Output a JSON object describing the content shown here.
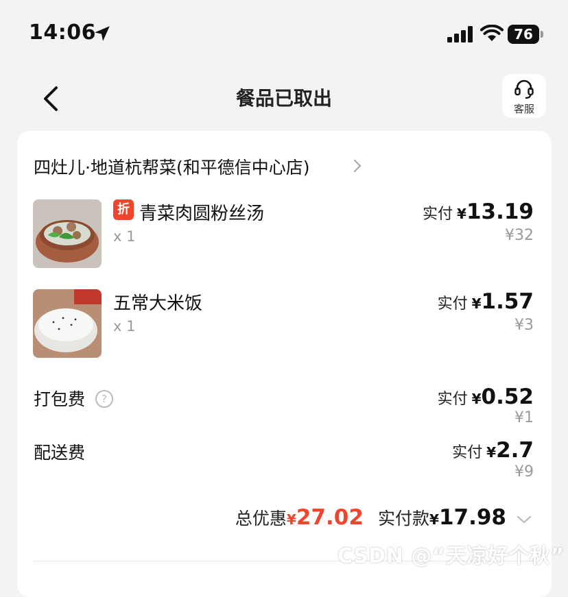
{
  "status_bar": {
    "time": "14:06",
    "battery": "76"
  },
  "nav": {
    "title": "餐品已取出",
    "service_label": "客服"
  },
  "shop": {
    "name": "四灶儿·地道杭帮菜(和平德信中心店)"
  },
  "items": [
    {
      "badge": "折",
      "name": "青菜肉圆粉丝汤",
      "qty": "x 1",
      "paid_label": "实付",
      "currency": "¥",
      "paid": "13.19",
      "original": "¥32"
    },
    {
      "name": "五常大米饭",
      "qty": "x 1",
      "paid_label": "实付",
      "currency": "¥",
      "paid": "1.57",
      "original": "¥3"
    }
  ],
  "fees": [
    {
      "label": "打包费",
      "help": "?",
      "paid_label": "实付",
      "currency": "¥",
      "paid": "0.52",
      "original": "¥1"
    },
    {
      "label": "配送费",
      "paid_label": "实付",
      "currency": "¥",
      "paid": "2.7",
      "original": "¥9"
    }
  ],
  "summary": {
    "discount_label": "总优惠",
    "discount_currency": "¥",
    "discount": "27.02",
    "total_label": "实付款",
    "total_currency": "¥",
    "total": "17.98"
  },
  "watermark": "CSDN @“天凉好个秋”",
  "colors": {
    "accent_red": "#f0452c",
    "background": "#f3f3f3",
    "card": "#ffffff"
  }
}
